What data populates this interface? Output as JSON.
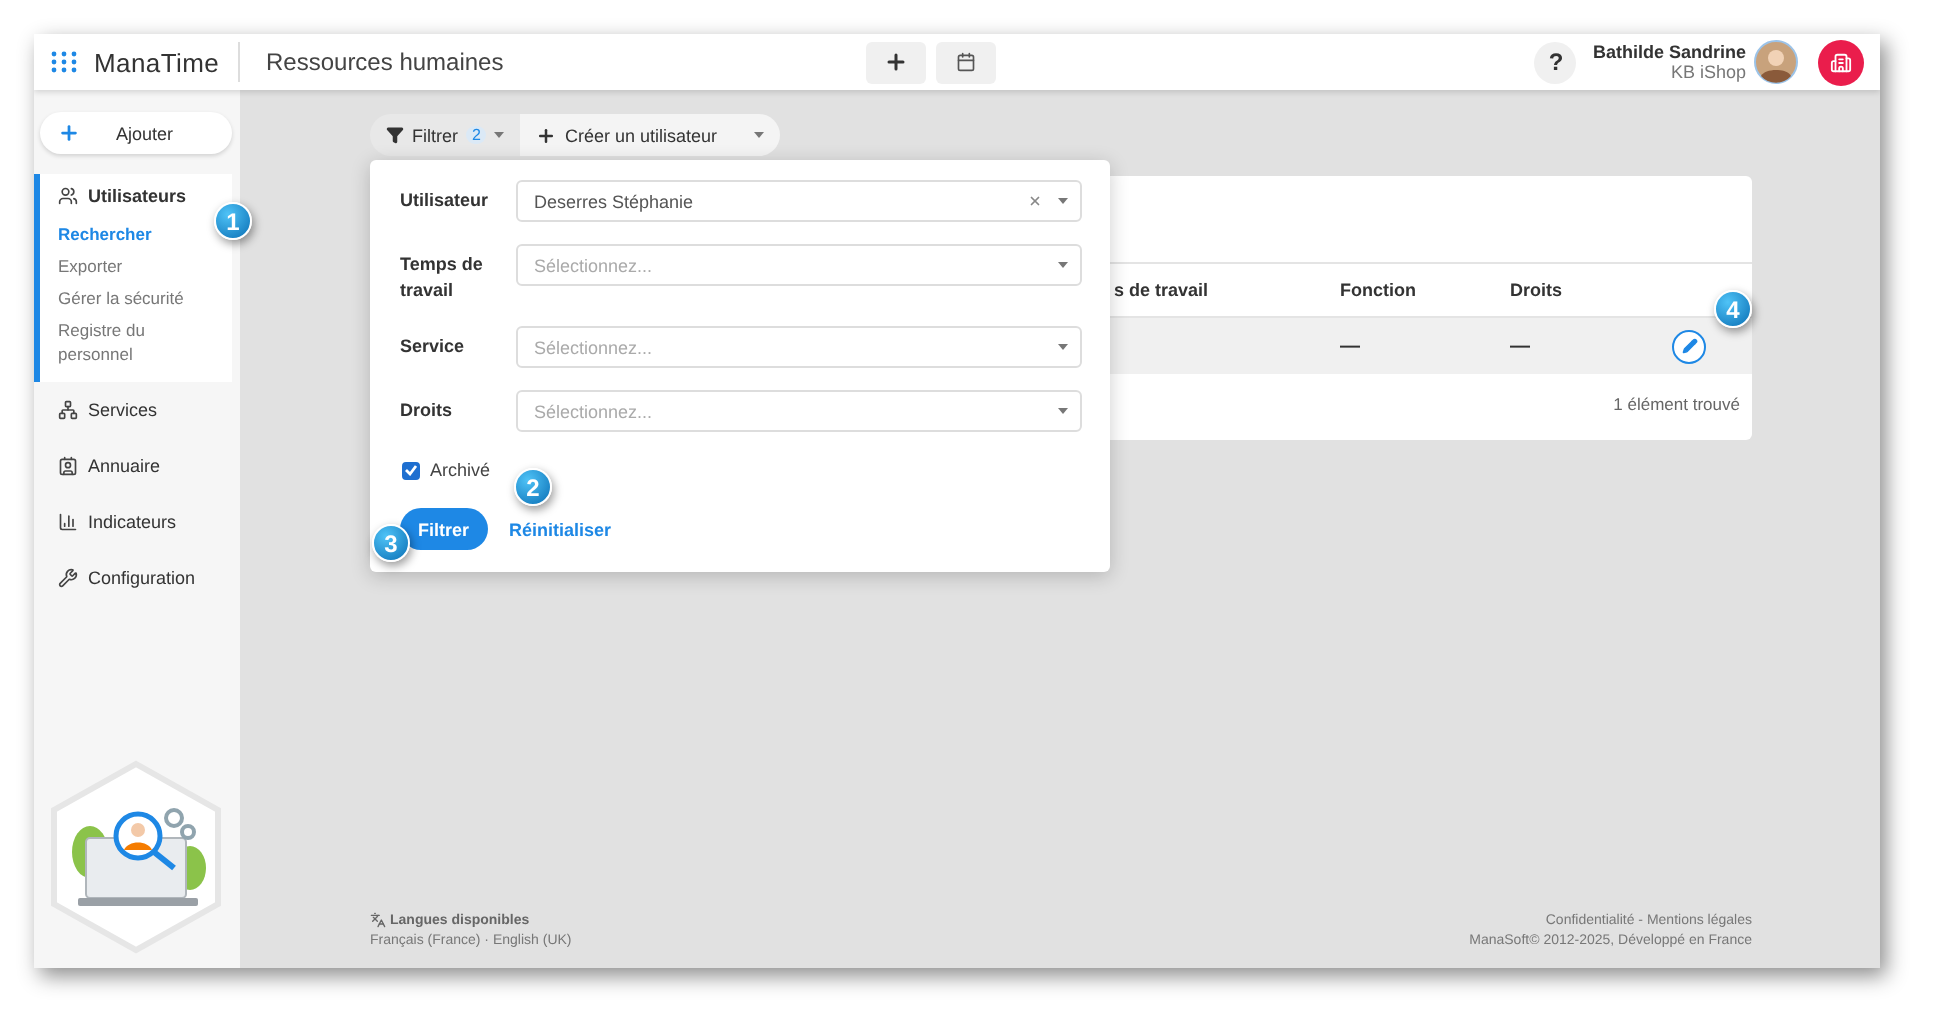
{
  "app": {
    "name": "ManaTime",
    "section": "Ressources humaines"
  },
  "header": {
    "help_label": "?",
    "user_name": "Bathilde Sandrine",
    "company": "KB iShop"
  },
  "sidebar": {
    "add_label": "Ajouter",
    "groups": [
      {
        "label": "Utilisateurs",
        "expanded": true,
        "children": [
          {
            "label": "Rechercher",
            "selected": true
          },
          {
            "label": "Exporter",
            "selected": false
          },
          {
            "label": "Gérer la sécurité",
            "selected": false
          },
          {
            "label": "Registre du personnel",
            "selected": false
          }
        ]
      },
      {
        "label": "Services",
        "expanded": false
      },
      {
        "label": "Annuaire",
        "expanded": false
      },
      {
        "label": "Indicateurs",
        "expanded": false
      },
      {
        "label": "Configuration",
        "expanded": false
      }
    ]
  },
  "toolbar": {
    "filter_label": "Filtrer",
    "filter_count": "2",
    "create_label": "Créer un utilisateur"
  },
  "filter_panel": {
    "fields": [
      {
        "label": "Utilisateur",
        "value": "Deserres Stéphanie"
      },
      {
        "label": "Temps de travail",
        "placeholder": "Sélectionnez..."
      },
      {
        "label": "Service",
        "placeholder": "Sélectionnez..."
      },
      {
        "label": "Droits",
        "placeholder": "Sélectionnez..."
      }
    ],
    "archived": {
      "label": "Archivé",
      "checked": true
    },
    "apply_label": "Filtrer",
    "reset_label": "Réinitialiser"
  },
  "table": {
    "columns": [
      "s de travail",
      "Fonction",
      "Droits"
    ],
    "rows": [
      {
        "fonction": "—",
        "droits": "—"
      }
    ],
    "status": "1 élément trouvé"
  },
  "footer": {
    "languages_title": "Langues disponibles",
    "languages": "Français (France) · English (UK)",
    "links": "Confidentialité - Mentions légales",
    "copyright": "ManaSoft© 2012-2025, Développé en France"
  },
  "callouts": [
    "1",
    "2",
    "3",
    "4"
  ]
}
